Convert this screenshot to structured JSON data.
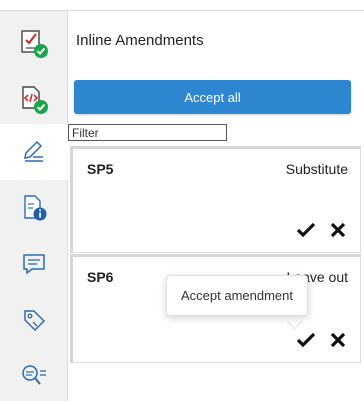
{
  "panel": {
    "title": "Inline Amendments",
    "accept_all_label": "Accept all",
    "filter_placeholder": "Filter"
  },
  "sidebar": {
    "items": [
      {
        "icon": "checklist-approved-icon",
        "active": false
      },
      {
        "icon": "code-approved-icon",
        "active": false
      },
      {
        "icon": "edit-document-icon",
        "active": true
      },
      {
        "icon": "document-info-icon",
        "active": false
      },
      {
        "icon": "comment-icon",
        "active": false
      },
      {
        "icon": "tag-icon",
        "active": false
      },
      {
        "icon": "search-list-icon",
        "active": false
      }
    ]
  },
  "amendments": [
    {
      "code": "SP5",
      "type": "Substitute"
    },
    {
      "code": "SP6",
      "type": "Leave out"
    }
  ],
  "tooltip": {
    "text": "Accept amendment"
  },
  "colors": {
    "accent": "#2e86d1",
    "approved_badge": "#1aa34a",
    "warning_red": "#d0312d"
  }
}
